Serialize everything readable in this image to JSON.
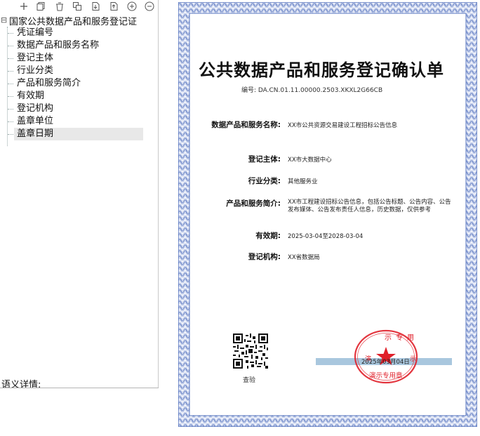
{
  "toolbar": {
    "buttons": [
      {
        "icon": "add-icon"
      },
      {
        "icon": "copy-icon"
      },
      {
        "icon": "delete-icon"
      },
      {
        "icon": "duplicate-icon"
      },
      {
        "icon": "import-icon"
      },
      {
        "icon": "export-icon"
      },
      {
        "icon": "zoom-in-icon"
      },
      {
        "icon": "zoom-out-icon"
      }
    ]
  },
  "tree": {
    "toggle": "⊟",
    "root_label": "国家公共数据产品和服务登记证",
    "items": [
      {
        "label": "凭证编号"
      },
      {
        "label": "数据产品和服务名称"
      },
      {
        "label": "登记主体"
      },
      {
        "label": "行业分类"
      },
      {
        "label": "产品和服务简介"
      },
      {
        "label": "有效期"
      },
      {
        "label": "登记机构"
      },
      {
        "label": "盖章单位"
      },
      {
        "label": "盖章日期"
      }
    ],
    "selected_index": 8
  },
  "detail": {
    "label": "语义详情:"
  },
  "certificate": {
    "title": "公共数据产品和服务登记确认单",
    "number": "编号: DA.CN.01.11.00000.2503.XKXL2G66CB",
    "fields": [
      {
        "label": "数据产品和服务名称:",
        "value": "XX市公共资源交易建设工程招标公告信息"
      },
      {
        "label": "登记主体:",
        "value": "XX市大数据中心"
      },
      {
        "label": "行业分类:",
        "value": "其他服务业"
      },
      {
        "label": "产品和服务简介:",
        "value": "XX市工程建设招标公告信息，包括公告标题、公告内容、公告发布媒体、公告发布责任人信息，历史数据，仅供参考"
      },
      {
        "label": "有效期:",
        "value": "2025-03-04至2028-03-04"
      },
      {
        "label": "登记机构:",
        "value": "XX省数据局"
      }
    ],
    "qr_caption": "查验",
    "stamp": {
      "top_text": "示专用",
      "side_text": "演",
      "side_text_right": "示",
      "bottom_text": "演示专用章",
      "date": "2025年03月04日",
      "color": "#e0202a"
    },
    "border_color": "#5b78c0"
  }
}
